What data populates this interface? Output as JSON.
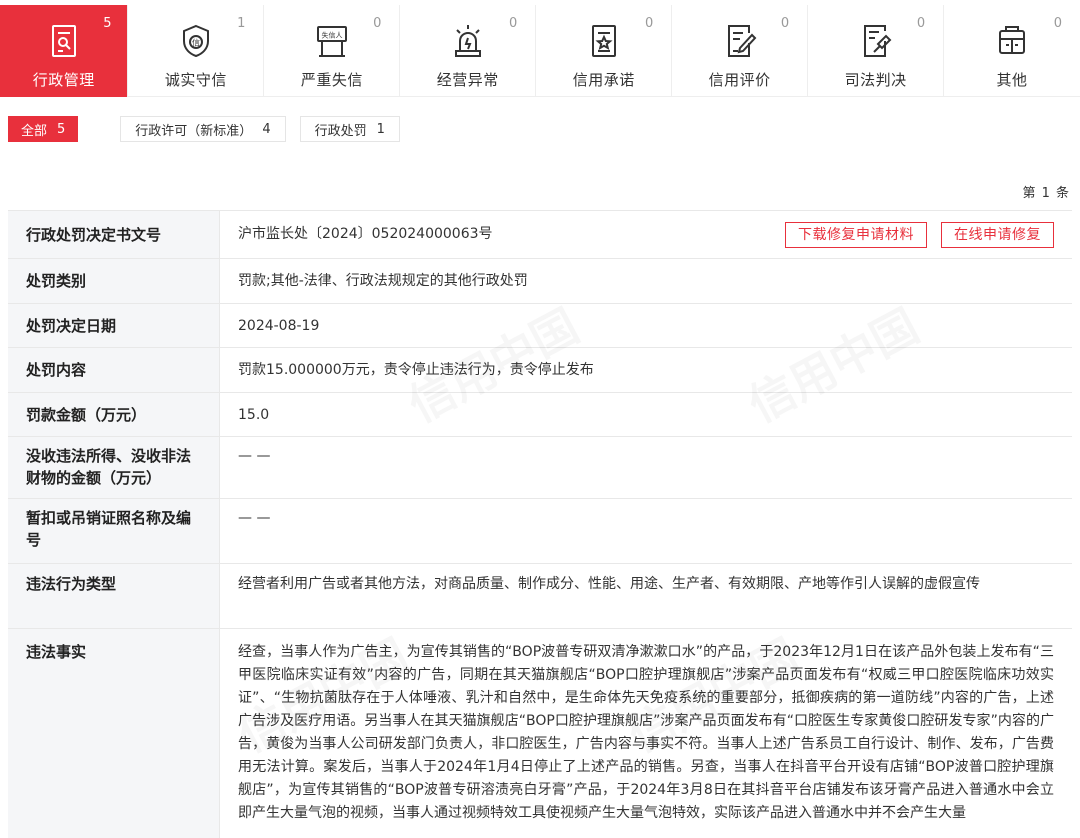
{
  "category_tabs": [
    {
      "label": "行政管理",
      "count": "5",
      "icon": "admin-doc-icon"
    },
    {
      "label": "诚实守信",
      "count": "1",
      "icon": "shield-trust-icon"
    },
    {
      "label": "严重失信",
      "count": "0",
      "icon": "dishonest-icon"
    },
    {
      "label": "经营异常",
      "count": "0",
      "icon": "alarm-light-icon"
    },
    {
      "label": "信用承诺",
      "count": "0",
      "icon": "promise-doc-icon"
    },
    {
      "label": "信用评价",
      "count": "0",
      "icon": "evaluation-icon"
    },
    {
      "label": "司法判决",
      "count": "0",
      "icon": "judgment-icon"
    },
    {
      "label": "其他",
      "count": "0",
      "icon": "other-icon"
    }
  ],
  "dishonest_icon_text": "失信人",
  "trust_icon_text": "信",
  "sub_filters": [
    {
      "label": "全部",
      "count": "5"
    },
    {
      "label": "行政许可（新标准）",
      "count": "4"
    },
    {
      "label": "行政处罚",
      "count": "1"
    }
  ],
  "pagination": {
    "label": "第 1 条"
  },
  "buttons": {
    "download": "下载修复申请材料",
    "online": "在线申请修复"
  },
  "watermark_text": "信用中国",
  "rows": [
    {
      "key": "行政处罚决定书文号",
      "value": "沪市监长处〔2024〕052024000063号"
    },
    {
      "key": "处罚类别",
      "value": "罚款;其他-法律、行政法规规定的其他行政处罚"
    },
    {
      "key": "处罚决定日期",
      "value": "2024-08-19"
    },
    {
      "key": "处罚内容",
      "value": "罚款15.000000万元，责令停止违法行为，责令停止发布"
    },
    {
      "key": "罚款金额（万元）",
      "value": "15.0"
    },
    {
      "key": "没收违法所得、没收非法财物的金额（万元）",
      "value": "— —"
    },
    {
      "key": "暂扣或吊销证照名称及编号",
      "value": "— —"
    },
    {
      "key": "违法行为类型",
      "value": "经营者利用广告或者其他方法，对商品质量、制作成分、性能、用途、生产者、有效期限、产地等作引人误解的虚假宣传"
    },
    {
      "key": "违法事实",
      "value": "经查，当事人作为广告主，为宣传其销售的“BOP波普专研双清净漱漱口水”的产品，于2023年12月1日在该产品外包装上发布有“三甲医院临床实证有效”内容的广告，同期在其天猫旗舰店“BOP口腔护理旗舰店”涉案产品页面发布有“权威三甲口腔医院临床功效实证”、“生物抗菌肽存在于人体唾液、乳汁和自然中，是生命体先天免疫系统的重要部分，抵御疾病的第一道防线”内容的广告，上述广告涉及医疗用语。另当事人在其天猫旗舰店“BOP口腔护理旗舰店”涉案产品页面发布有“口腔医生专家黄俊口腔研发专家”内容的广告，黄俊为当事人公司研发部门负责人，非口腔医生，广告内容与事实不符。当事人上述广告系员工自行设计、制作、发布，广告费用无法计算。案发后，当事人于2024年1月4日停止了上述产品的销售。另查，当事人在抖音平台开设有店铺“BOP波普口腔护理旗舰店”，为宣传其销售的“BOP波普专研溶渍亮白牙膏”产品，于2024年3月8日在其抖音平台店铺发布该牙膏产品进入普通水中会立即产生大量气泡的视频，当事人通过视频特效工具使视频产生大量气泡特效，实际该产品进入普通水中并不会产生大量"
    }
  ]
}
